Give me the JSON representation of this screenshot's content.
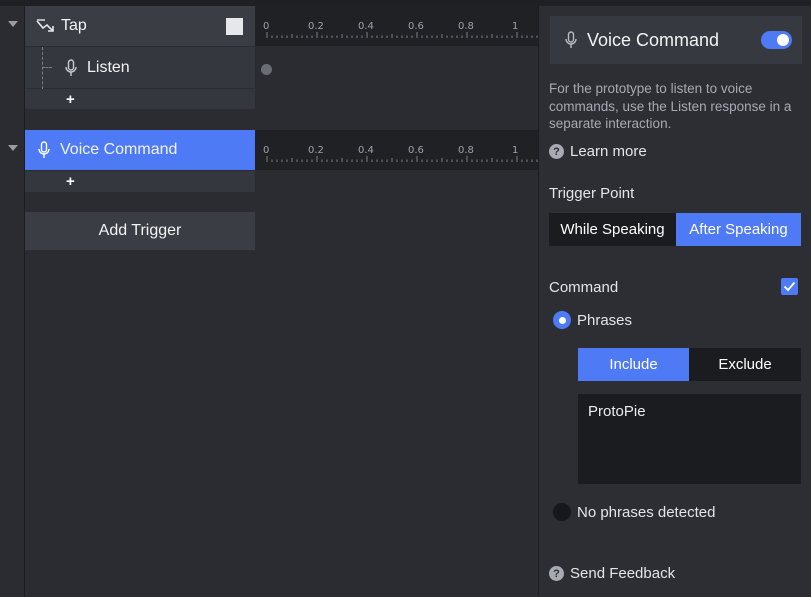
{
  "timeline": {
    "interactions": [
      {
        "trigger": {
          "label": "Tap",
          "icon": "tap-gesture-icon"
        },
        "responses": [
          {
            "label": "Listen",
            "icon": "microphone-icon"
          }
        ],
        "add_label": "+"
      },
      {
        "trigger": {
          "label": "Voice Command",
          "icon": "microphone-icon",
          "selected": true
        },
        "responses": [],
        "add_label": "+"
      }
    ],
    "ruler_ticks": [
      "0",
      "0.2",
      "0.4",
      "0.6",
      "0.8",
      "1"
    ],
    "add_trigger_label": "Add Trigger"
  },
  "panel": {
    "title": "Voice Command",
    "enabled": true,
    "description": "For the prototype to listen to voice commands, use the Listen response in a separate interaction.",
    "learn_more": "Learn more",
    "trigger_point": {
      "label": "Trigger Point",
      "options": [
        "While Speaking",
        "After Speaking"
      ],
      "selected": "After Speaking"
    },
    "command": {
      "label": "Command",
      "checked": true,
      "phrases_label": "Phrases",
      "mode_options": [
        "Include",
        "Exclude"
      ],
      "mode_selected": "Include",
      "phrases_value": "ProtoPie",
      "no_phrases_label": "No phrases detected"
    },
    "send_feedback": "Send Feedback"
  },
  "colors": {
    "accent": "#4e7bf5",
    "panel_bg": "#2c2e33",
    "ruler_bg": "#1f2125"
  }
}
